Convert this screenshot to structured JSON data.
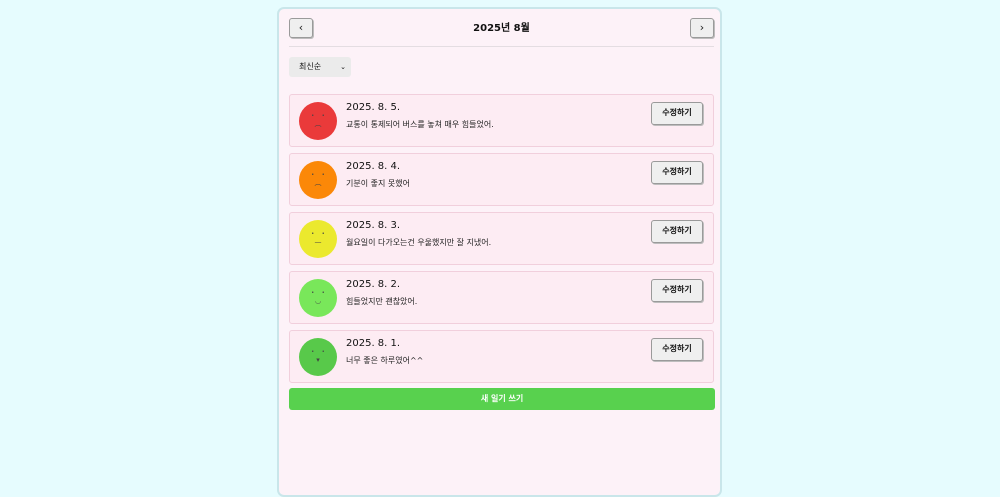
{
  "header": {
    "prev_label": "‹",
    "title": "2025년 8월",
    "next_label": "›"
  },
  "sort": {
    "selected": "최신순",
    "caret": "⌄"
  },
  "entries": [
    {
      "date": "2025. 8. 5.",
      "text": "교통이 통제되어 버스를 놓쳐 매우 힘들었어.",
      "edit_label": "수정하기",
      "mood_color": "#ea3a3a",
      "eyes": "•  •",
      "mouth": "︵"
    },
    {
      "date": "2025. 8. 4.",
      "text": "기분이 좋지 못했어",
      "edit_label": "수정하기",
      "mood_color": "#fb8808",
      "eyes": "•  •",
      "mouth": "︵"
    },
    {
      "date": "2025. 8. 3.",
      "text": "월요일이 다가오는건 우울했지만 잘 지냈어.",
      "edit_label": "수정하기",
      "mood_color": "#ebe92e",
      "eyes": "•  •",
      "mouth": "—"
    },
    {
      "date": "2025. 8. 2.",
      "text": "힘들었지만 괜찮았어.",
      "edit_label": "수정하기",
      "mood_color": "#79e75a",
      "eyes": "•  •",
      "mouth": "◡"
    },
    {
      "date": "2025. 8. 1.",
      "text": "너무 좋은 하루였어^^",
      "edit_label": "수정하기",
      "mood_color": "#58c94a",
      "eyes": "•  •",
      "mouth": "▾"
    }
  ],
  "new_entry_label": "새 일기 쓰기"
}
